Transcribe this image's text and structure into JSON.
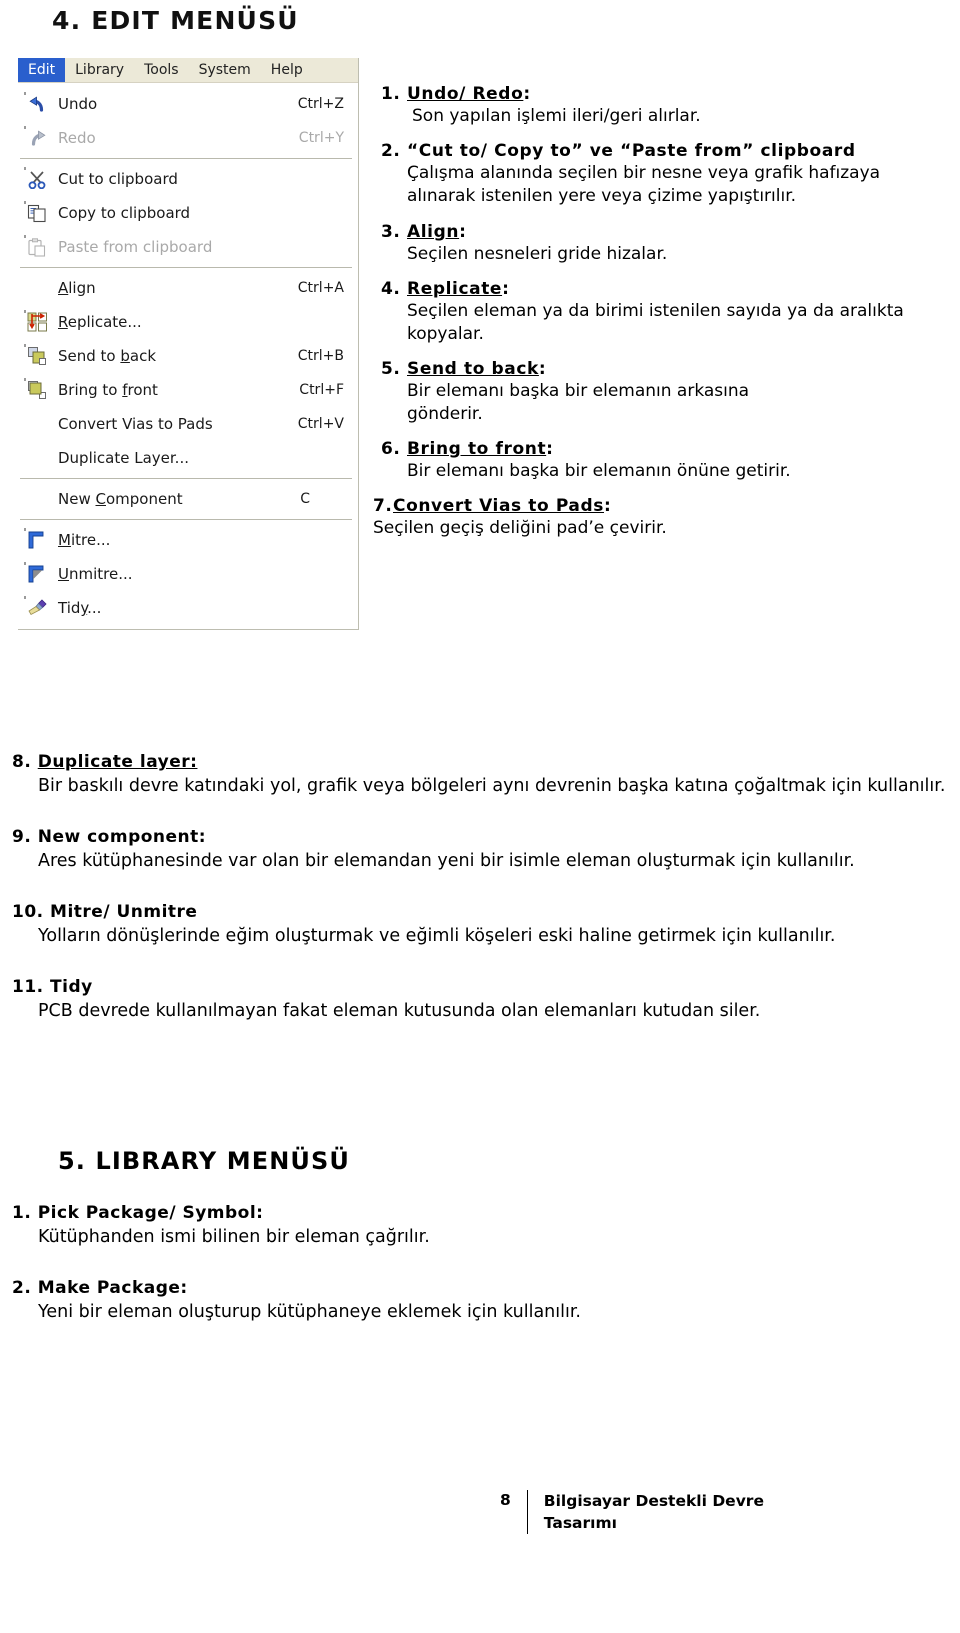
{
  "page_title": "4. EDIT MENÜSÜ",
  "menu_screenshot": {
    "menubar": [
      {
        "label": "Edit",
        "active": true
      },
      {
        "label": "Library",
        "active": false
      },
      {
        "label": "Tools",
        "active": false
      },
      {
        "label": "System",
        "active": false
      },
      {
        "label": "Help",
        "active": false
      }
    ],
    "items": [
      {
        "icon": "undo-arrow-icon",
        "label": "Undo",
        "accel": "Ctrl+Z",
        "disabled": false,
        "sep_after": false
      },
      {
        "icon": "redo-arrow-icon",
        "label": "Redo",
        "accel": "Ctrl+Y",
        "disabled": true,
        "sep_after": true
      },
      {
        "icon": "scissors-icon",
        "label": "Cut to clipboard",
        "accel": "",
        "disabled": false,
        "sep_after": false
      },
      {
        "icon": "copy-pages-icon",
        "label": "Copy to clipboard",
        "accel": "",
        "disabled": false,
        "sep_after": false
      },
      {
        "icon": "clipboard-paste-icon",
        "label": "Paste from clipboard",
        "accel": "",
        "disabled": true,
        "sep_after": true
      },
      {
        "icon": "none",
        "label": "Align",
        "accel": "Ctrl+A",
        "disabled": false,
        "sep_after": false
      },
      {
        "icon": "replicate-grid-icon",
        "label": "Replicate...",
        "accel": "",
        "disabled": false,
        "sep_after": false
      },
      {
        "icon": "send-to-back-icon",
        "label": "Send to back",
        "accel": "Ctrl+B",
        "disabled": false,
        "sep_after": false
      },
      {
        "icon": "bring-to-front-icon",
        "label": "Bring to front",
        "accel": "Ctrl+F",
        "disabled": false,
        "sep_after": false
      },
      {
        "icon": "none",
        "label": "Convert Vias to Pads",
        "accel": "Ctrl+V",
        "disabled": false,
        "sep_after": false
      },
      {
        "icon": "none",
        "label": "Duplicate Layer...",
        "accel": "",
        "disabled": false,
        "sep_after": true
      },
      {
        "icon": "none",
        "label": "New Component",
        "accel": "C",
        "disabled": false,
        "sep_after": true
      },
      {
        "icon": "mitre-corner-icon",
        "label": "Mitre...",
        "accel": "",
        "disabled": false,
        "sep_after": false
      },
      {
        "icon": "unmitre-corner-icon",
        "label": "Unmitre...",
        "accel": "",
        "disabled": false,
        "sep_after": false
      },
      {
        "icon": "broom-icon",
        "label": "Tidy...",
        "accel": "",
        "disabled": false,
        "sep_after": false
      }
    ],
    "colors": {
      "menubar_bg": "#ece9d8",
      "highlight_bg": "#2a5fcd",
      "highlight_fg": "#ffffff",
      "disabled_fg": "#a9a9a9"
    }
  },
  "side_list": [
    {
      "num": "1.",
      "title": "Undo/ Redo",
      "colon": ":",
      "body": "Son yapılan işlemi ileri/geri alırlar."
    },
    {
      "num": "2.",
      "title": "“Cut to/ Copy to” ve “Paste from” clipboard",
      "colon": "",
      "body": "Çalışma alanında seçilen bir nesne veya grafik hafızaya alınarak istenilen yere veya çizime yapıştırılır."
    },
    {
      "num": "3.",
      "title": "Align",
      "colon": ":",
      "body": "Seçilen nesneleri gride hizalar."
    },
    {
      "num": "4.",
      "title": "Replicate",
      "colon": ":",
      "body": "Seçilen eleman ya da birimi istenilen sayıda ya da aralıkta kopyalar."
    },
    {
      "num": "5.",
      "title": "Send to back",
      "colon": ":",
      "body": "Bir elemanı başka bir elemanın arkasına gönderir."
    },
    {
      "num": "6.",
      "title": "Bring to front",
      "colon": ":",
      "body": "Bir elemanı başka bir elemanın önüne getirir."
    },
    {
      "num": "7.",
      "title": "Convert Vias to Pads",
      "colon": ":",
      "body": "Seçilen geçiş deliğini pad’e çevirir."
    }
  ],
  "wide_list": [
    {
      "num": "8.",
      "title": "Duplicate layer:",
      "body": "Bir baskılı devre katındaki yol, grafik veya bölgeleri aynı devrenin başka katına çoğaltmak için kullanılır."
    },
    {
      "num": "9.",
      "title": "New component:",
      "body": "Ares kütüphanesinde var olan bir elemandan yeni bir isimle eleman oluşturmak için kullanılır."
    },
    {
      "num": "10.",
      "title": "Mitre/ Unmitre",
      "body": "Yolların dönüşlerinde eğim oluşturmak ve eğimli köşeleri eski haline getirmek için kullanılır."
    },
    {
      "num": "11.",
      "title": "Tidy",
      "body": "PCB devrede kullanılmayan fakat eleman kutusunda olan elemanları kutudan siler."
    }
  ],
  "section5_title": "5. LIBRARY MENÜSÜ",
  "library_list": [
    {
      "num": "1.",
      "title": "Pick Package/ Symbol:",
      "body": "Kütüphanden ismi bilinen bir eleman çağrılır."
    },
    {
      "num": "2.",
      "title": "Make Package:",
      "body": "Yeni bir eleman oluşturup kütüphaneye eklemek için kullanılır."
    }
  ],
  "footer": {
    "page_number": "8",
    "text": "Bilgisayar Destekli Devre Tasarımı"
  }
}
